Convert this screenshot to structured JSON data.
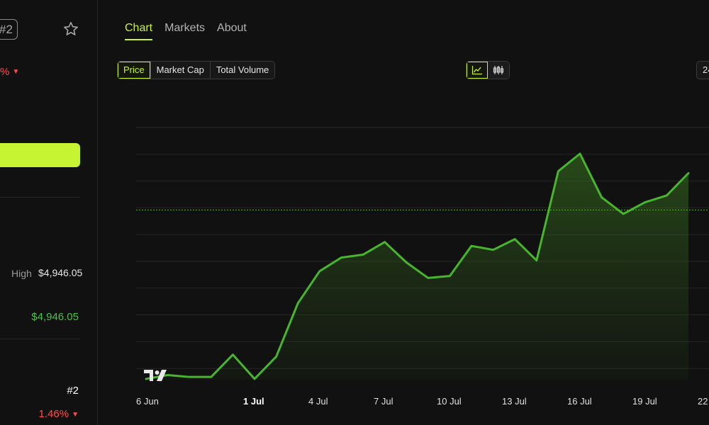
{
  "sidebar": {
    "rank_badge": "#2",
    "top_change": "%",
    "high_label": "High",
    "high_value": "$4,946.05",
    "green_value": "$4,946.05",
    "rank_value": "#2",
    "bottom_change": "1.46%",
    "down_arrow": "▼"
  },
  "tabs": [
    {
      "label": "Chart",
      "active": true
    },
    {
      "label": "Markets",
      "active": false
    },
    {
      "label": "About",
      "active": false
    }
  ],
  "metrics": [
    {
      "label": "Price",
      "active": true
    },
    {
      "label": "Market Cap",
      "active": false
    },
    {
      "label": "Total Volume",
      "active": false
    }
  ],
  "chart_type_toggle": [
    {
      "icon": "line-chart-icon",
      "active": true
    },
    {
      "icon": "candlestick-icon",
      "active": false
    }
  ],
  "range_label": "24",
  "colors": {
    "accent": "#c6f432",
    "line": "#48b52c",
    "negative": "#ff4d4d",
    "positive": "#48c243",
    "background": "#111111"
  },
  "chart_data": {
    "type": "area",
    "x_tick_labels": [
      "6 Jun",
      "1 Jul",
      "4 Jul",
      "7 Jul",
      "10 Jul",
      "13 Jul",
      "16 Jul",
      "19 Jul",
      "22"
    ],
    "x_tick_emphasis": [
      false,
      true,
      false,
      false,
      false,
      false,
      false,
      false,
      false
    ],
    "x": [
      "28 Jun",
      "29 Jun",
      "30 Jun",
      "1 Jul",
      "2 Jul",
      "3 Jul",
      "4 Jul",
      "5 Jul",
      "6 Jul",
      "7 Jul",
      "8 Jul",
      "9 Jul",
      "10 Jul",
      "11 Jul",
      "12 Jul",
      "13 Jul",
      "14 Jul",
      "15 Jul",
      "16 Jul",
      "17 Jul",
      "18 Jul",
      "19 Jul",
      "20 Jul",
      "21 Jul",
      "22 Jul",
      "23 Jul"
    ],
    "index_values": [
      1,
      5,
      3,
      3,
      26,
      1,
      24,
      79,
      112,
      126,
      129,
      142,
      121,
      105,
      107,
      138,
      134,
      145,
      123,
      215,
      233,
      188,
      171,
      183,
      190,
      213
    ],
    "baseline_index": 175,
    "y_range": [
      -10,
      260
    ],
    "grid": true,
    "y_axis_labels_shown": false
  }
}
